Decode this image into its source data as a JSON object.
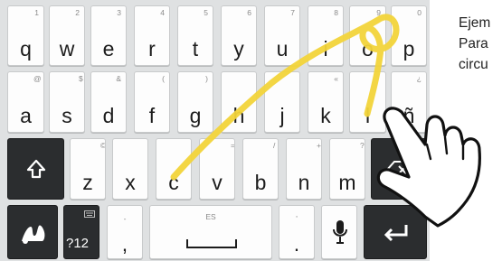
{
  "keyboard": {
    "rows": [
      [
        {
          "id": "q",
          "label": "q",
          "hint": "1"
        },
        {
          "id": "w",
          "label": "w",
          "hint": "2"
        },
        {
          "id": "e",
          "label": "e",
          "hint": "3"
        },
        {
          "id": "r",
          "label": "r",
          "hint": "4"
        },
        {
          "id": "t",
          "label": "t",
          "hint": "5"
        },
        {
          "id": "y",
          "label": "y",
          "hint": "6"
        },
        {
          "id": "u",
          "label": "u",
          "hint": "7"
        },
        {
          "id": "i",
          "label": "i",
          "hint": "8"
        },
        {
          "id": "o",
          "label": "o",
          "hint": "9"
        },
        {
          "id": "p",
          "label": "p",
          "hint": "0"
        }
      ],
      [
        {
          "id": "a",
          "label": "a",
          "hint": "@"
        },
        {
          "id": "s",
          "label": "s",
          "hint": "$"
        },
        {
          "id": "d",
          "label": "d",
          "hint": "&"
        },
        {
          "id": "f",
          "label": "f",
          "hint": "("
        },
        {
          "id": "g",
          "label": "g",
          "hint": ")"
        },
        {
          "id": "h",
          "label": "h",
          "hint": ""
        },
        {
          "id": "j",
          "label": "j",
          "hint": ""
        },
        {
          "id": "k",
          "label": "k",
          "hint": "«"
        },
        {
          "id": "l",
          "label": "l",
          "hint": ""
        },
        {
          "id": "enye",
          "label": "ñ",
          "hint": "¿"
        }
      ],
      [
        {
          "id": "shift",
          "label": "",
          "hint": "",
          "icon": "shift-icon"
        },
        {
          "id": "z",
          "label": "z",
          "hint": "©"
        },
        {
          "id": "x",
          "label": "x",
          "hint": "!"
        },
        {
          "id": "c",
          "label": "c",
          "hint": ""
        },
        {
          "id": "v",
          "label": "v",
          "hint": "="
        },
        {
          "id": "b",
          "label": "b",
          "hint": "/"
        },
        {
          "id": "n",
          "label": "n",
          "hint": "+"
        },
        {
          "id": "m",
          "label": "m",
          "hint": "?"
        },
        {
          "id": "backspace",
          "label": "",
          "hint": "",
          "icon": "backspace-icon"
        }
      ],
      [
        {
          "id": "swype",
          "label": "",
          "hint": "",
          "icon": "swype-logo-icon"
        },
        {
          "id": "symbols",
          "label": "?12",
          "hint": "",
          "icon": "keyboard-icon"
        },
        {
          "id": "comma",
          "label": ",",
          "hint": "-"
        },
        {
          "id": "space",
          "label": "",
          "hint": "ES",
          "icon": "space-bar-icon"
        },
        {
          "id": "period",
          "label": ".",
          "hint": "'"
        },
        {
          "id": "mic",
          "label": "",
          "hint": "",
          "icon": "microphone-icon"
        },
        {
          "id": "enter",
          "label": "",
          "hint": "",
          "icon": "enter-icon"
        }
      ]
    ]
  },
  "caption": {
    "lines": [
      "Ejem",
      "Para",
      "circu"
    ]
  },
  "overlay": {
    "trace_icon": "swipe-trace-icon",
    "hand_icon": "pointing-hand-icon"
  },
  "colors": {
    "background": "#dfe1e2",
    "key_light": "#fdfdfd",
    "key_dark": "#2b2d2f",
    "trace": "#f2d43a"
  }
}
